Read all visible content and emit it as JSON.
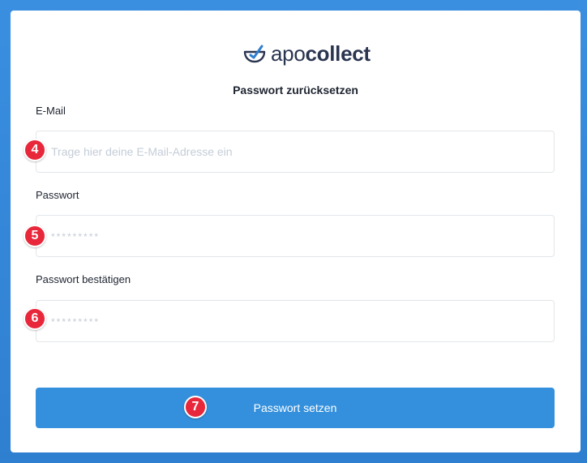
{
  "brand": {
    "name_light": "apo",
    "name_bold": "collect"
  },
  "page_title": "Passwort zurücksetzen",
  "form": {
    "email_label": "E-Mail",
    "email_placeholder": "Trage hier deine E-Mail-Adresse ein",
    "password_label": "Passwort",
    "password_placeholder": "*********",
    "confirm_label": "Passwort bestätigen",
    "confirm_placeholder": "*********",
    "submit_label": "Passwort setzen"
  },
  "badges": [
    "4",
    "5",
    "6",
    "7"
  ],
  "colors": {
    "background": "#3a8fe0",
    "accent": "#3490dc",
    "badge": "#e8273a",
    "logo_mark": "#2f7fd0",
    "logo_text": "#2a3550"
  }
}
